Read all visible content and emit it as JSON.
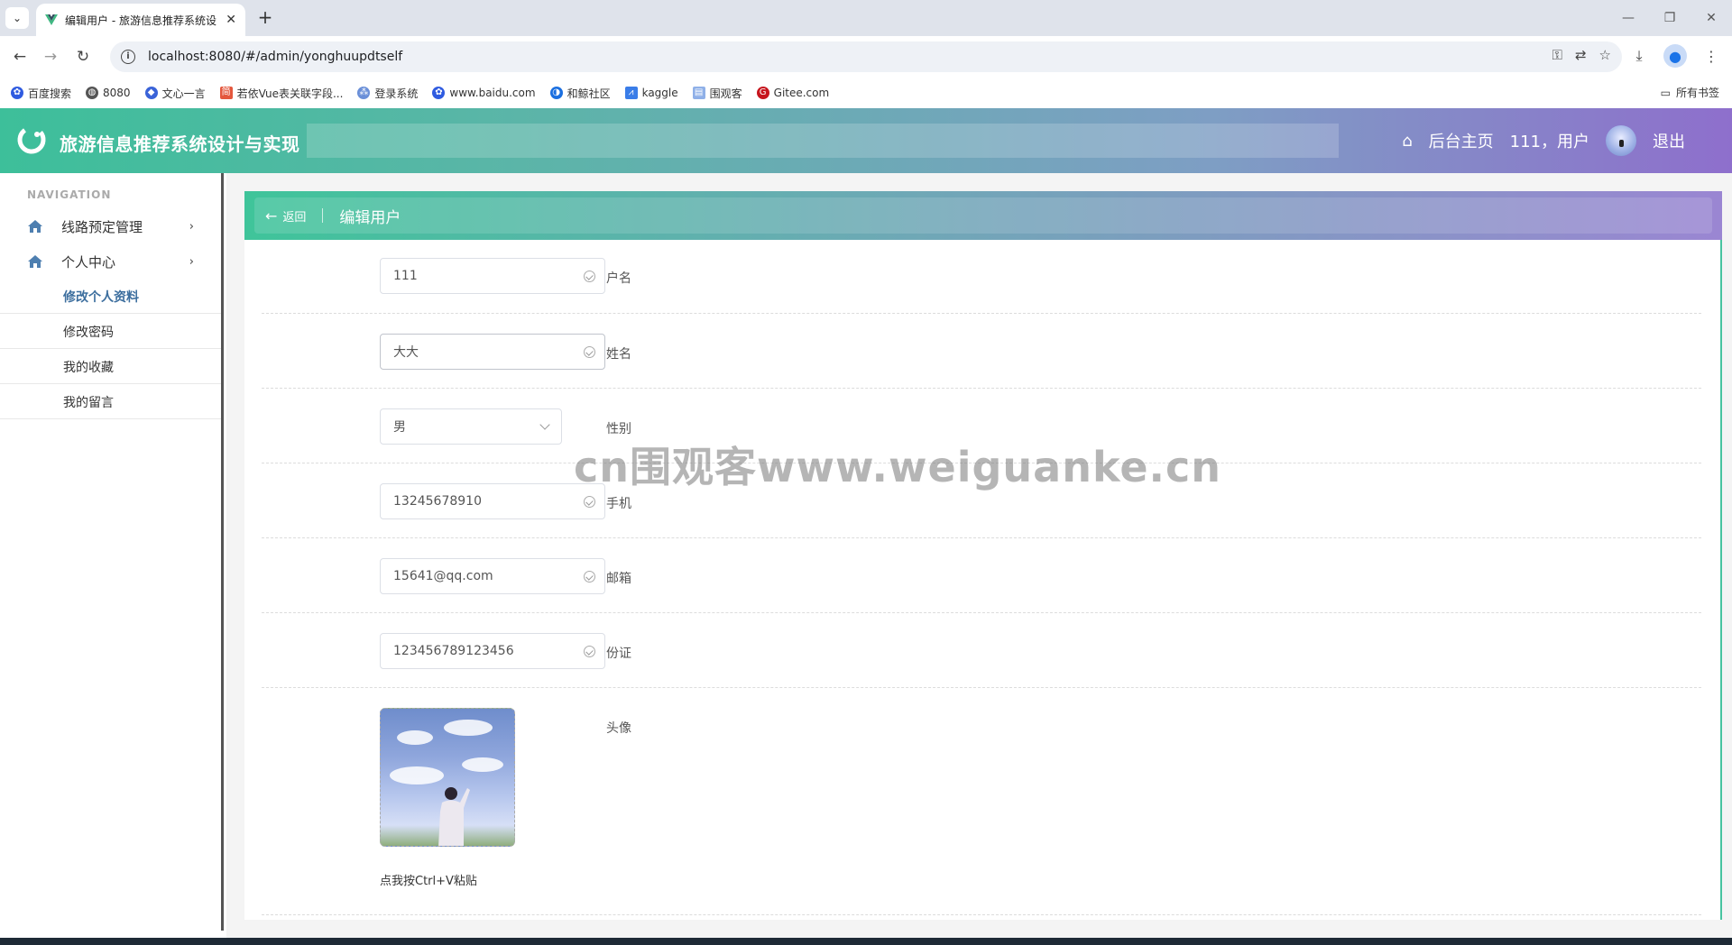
{
  "browser": {
    "tab_title": "编辑用户 - 旅游信息推荐系统设",
    "url": "localhost:8080/#/admin/yonghuupdtself",
    "bookmarks": [
      "百度搜索",
      "8080",
      "文心一言",
      "若依Vue表关联字段...",
      "登录系统",
      "www.baidu.com",
      "和鲸社区",
      "kaggle",
      "围观客",
      "Gitee.com"
    ],
    "all_bookmarks": "所有书签"
  },
  "header": {
    "site_title": "旅游信息推荐系统设计与实现",
    "home_link": "后台主页",
    "user_label": "111，用户",
    "logout": "退出"
  },
  "sidebar": {
    "caption": "NAVIGATION",
    "groups": [
      {
        "label": "线路预定管理"
      },
      {
        "label": "个人中心"
      }
    ],
    "sub_items": [
      "修改个人资料",
      "修改密码",
      "我的收藏",
      "我的留言"
    ]
  },
  "page": {
    "back_label": "返回",
    "title": "编辑用户"
  },
  "form": {
    "username": {
      "label": "用户名",
      "value": "111"
    },
    "name": {
      "label": "姓名",
      "value": "大大"
    },
    "gender": {
      "label": "性别",
      "value": "男"
    },
    "phone": {
      "label": "手机",
      "value": "13245678910"
    },
    "email": {
      "label": "邮箱",
      "value": "15641@qq.com"
    },
    "id_card": {
      "label": "身份证",
      "value": "123456789123456"
    },
    "avatar": {
      "label": "头像",
      "paste_hint": "点我按Ctrl+V粘贴"
    }
  },
  "watermark": "cn围观客www.weiguanke.cn",
  "colors": {
    "header_start": "#3dbf9a",
    "header_end": "#8e6fcc",
    "required": "#f56c6c",
    "active_menu": "#3c6e9e"
  }
}
